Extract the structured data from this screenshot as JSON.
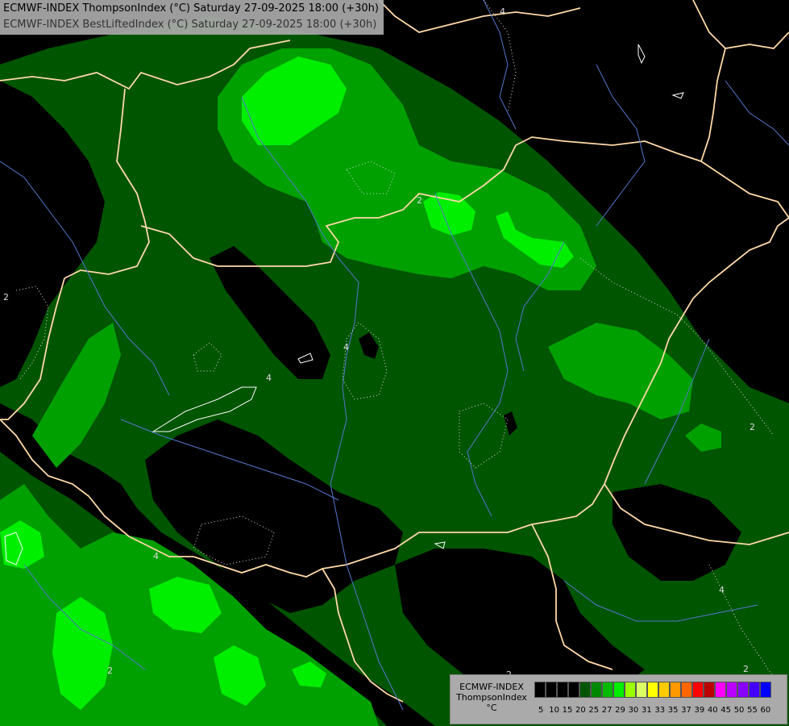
{
  "title": {
    "line1": "ECMWF-INDEX ThompsonIndex (°C) Saturday 27-09-2025 18:00 (+30h)",
    "line2": "ECMWF-INDEX BestLiftedIndex (°C) Saturday 27-09-2025 18:00 (+30h)"
  },
  "legend": {
    "title1": "ECMWF-INDEX",
    "title2": "ThompsonIndex",
    "unit": "°C",
    "colors": [
      "#000000",
      "#000000",
      "#000000",
      "#000000",
      "#005500",
      "#008800",
      "#00bb00",
      "#00ee00",
      "#99ff00",
      "#ddff66",
      "#ffff00",
      "#ffcc00",
      "#ff9900",
      "#ff6600",
      "#ff0000",
      "#bb0000",
      "#ff00ff",
      "#bb00ff",
      "#8800ff",
      "#4400ff",
      "#0000ff"
    ],
    "ticks": [
      "5",
      "10",
      "15",
      "20",
      "25",
      "27",
      "29",
      "30",
      "31",
      "33",
      "35",
      "37",
      "39",
      "40",
      "45",
      "50",
      "55",
      "60"
    ]
  },
  "contour_labels": [
    "2",
    "4",
    "4",
    "4",
    "2",
    "2",
    "4",
    "2",
    "2",
    "2",
    "4"
  ],
  "map_colors": {
    "background": "#000000",
    "dark_green": "#005500",
    "mid_green": "#00a000",
    "bright_green": "#00ee00",
    "borders": "#ffd9a8",
    "rivers": "#5577cc"
  }
}
